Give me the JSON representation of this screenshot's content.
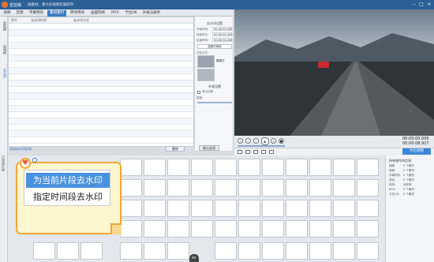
{
  "window": {
    "app_title": "爱剪辑",
    "doc_title": "剧素材、集大的视频剪辑软件"
  },
  "tabs": [
    {
      "label": "视频"
    },
    {
      "label": "音频"
    },
    {
      "label": "字幕特效"
    },
    {
      "label": "叠加素材"
    },
    {
      "label": "转场特效"
    },
    {
      "label": "画面风格"
    },
    {
      "label": "MTV"
    },
    {
      "label": "卡拉OK"
    },
    {
      "label": "升级与服务"
    }
  ],
  "left_nav": [
    {
      "label": "加贴图"
    },
    {
      "label": "加相框"
    },
    {
      "label": "去水印"
    }
  ],
  "table": {
    "col1": "序号",
    "col2": "去水印时间",
    "col3": "去水印方式"
  },
  "add_button": "添加去水印区域",
  "delete_button": "删除",
  "confirm_button": "确认修改",
  "settings": {
    "section1": "去水印设置",
    "fields": [
      {
        "label": "开始时间:",
        "value": "00:00:00.000"
      },
      {
        "label": "持续时长:",
        "value": "00:00:00.000"
      },
      {
        "label": "结束时间:",
        "value": "00:00:00.000"
      }
    ],
    "pick_time_button": "选取时间段",
    "method_label": "去除方式:",
    "style_name": "模糊式",
    "section2": "外观设置",
    "checkbox_label": "显示边框",
    "scale_label": "程度:"
  },
  "transport": {
    "time_current": "00:00:00.000",
    "time_total": "00:00:08.917"
  },
  "export_button": "导出视频",
  "timeline_label": "已添加片段",
  "popup": {
    "option1": "为当前片段去水印",
    "option2": "指定时间段去水印"
  },
  "props": {
    "title": "所有制作的信息:",
    "items": [
      {
        "l": "视频:",
        "r": "0 个素材"
      },
      {
        "l": "音频:",
        "r": "0 个素材"
      },
      {
        "l": "字幕特效:",
        "r": "0 个素材"
      },
      {
        "l": "叠加:",
        "r": "0 个素材"
      },
      {
        "l": "转场:",
        "r": "无转场"
      },
      {
        "l": "MTV:",
        "r": "0 个素材"
      },
      {
        "l": "卡拉OK:",
        "r": "0 个素材"
      }
    ]
  }
}
